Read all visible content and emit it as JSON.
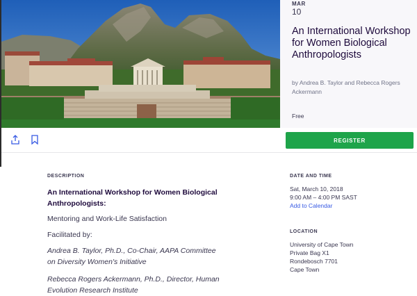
{
  "hero": {
    "icon": "hero-photo"
  },
  "event": {
    "month": "MAR",
    "day": "10",
    "title": "An International Workshop for Women Biological Anthropologists",
    "organizer": "by Andrea B. Taylor and Rebecca Rogers Ackermann",
    "price": "Free"
  },
  "actions": {
    "share_icon": "share-icon",
    "bookmark_icon": "bookmark-icon",
    "register_label": "REGISTER",
    "register_color": "#1ea44a"
  },
  "description": {
    "label": "DESCRIPTION",
    "heading": "An International Workshop for Women Biological Anthropologists:",
    "subtitle": "Mentoring and Work-Life Satisfaction",
    "facilitated": "Facilitated by:",
    "person1": "Andrea B. Taylor, Ph.D., Co-Chair, AAPA Committee on Diversity Women's Initiative",
    "person2": "Rebecca Rogers Ackermann, Ph.D., Director, Human Evolution Research Institute"
  },
  "date_time": {
    "label": "DATE AND TIME",
    "date": "Sat, March 10, 2018",
    "time": "9:00 AM – 4:00 PM SAST",
    "calendar_link": "Add to Calendar"
  },
  "location": {
    "label": "LOCATION",
    "line1": "University of Cape Town",
    "line2": "Private Bag X1",
    "line3": "Rondebosch 7701",
    "line4": "Cape Town"
  }
}
